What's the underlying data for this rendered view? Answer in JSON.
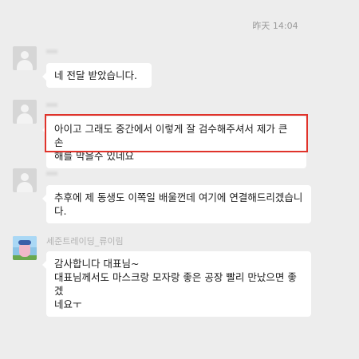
{
  "chat": {
    "timestamp": "昨天 14:04",
    "messages": [
      {
        "sender_name": "",
        "avatar": "default-avatar",
        "text": "네 전달 받았습니다."
      },
      {
        "sender_name": "",
        "avatar": "default-avatar",
        "text": "아이고 그래도 중간에서 이렇게 잘 검수해주셔서 제가 큰 손\n해를 막을수 있네요",
        "highlighted": true,
        "highlight_color": "#e0332b"
      },
      {
        "sender_name": "",
        "avatar": "default-avatar",
        "text": "추후에 제 동생도 이쪽일 배울껀데 여기에 연결해드리겠습니\n다."
      },
      {
        "sender_name": "세준트레이딩_류이림",
        "avatar": "photo-avatar",
        "text": "감사합니다 대표님~\n대표님께서도 마스크랑 모자랑 좋은 공장 빨리 만났으면 좋겠\n네요ㅜ"
      }
    ]
  }
}
